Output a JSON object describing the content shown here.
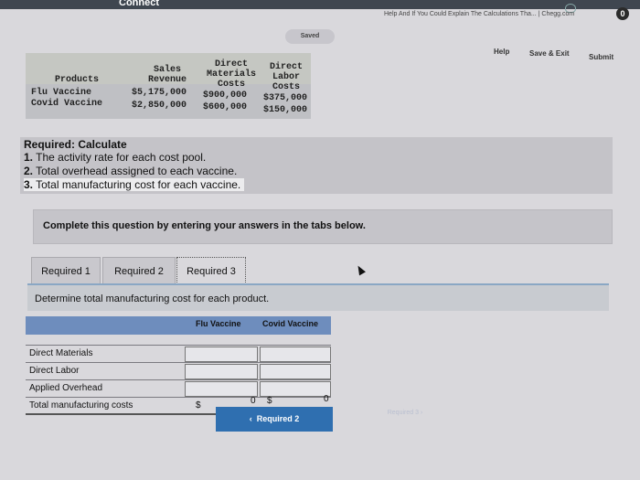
{
  "browser": {
    "connect_label": "Connect",
    "tab_title": "Help And If You Could Explain The Calculations Tha... | Chegg.com",
    "badge": "0"
  },
  "header": {
    "saved": "Saved",
    "help": "Help",
    "save_exit": "Save & Exit",
    "submit": "Submit"
  },
  "data_table": {
    "headers": {
      "products": "Products",
      "sales_revenue": [
        "Sales",
        "Revenue"
      ],
      "direct_materials": [
        "Direct",
        "Materials",
        "Costs"
      ],
      "direct_labor": [
        "Direct",
        "Labor",
        "Costs"
      ]
    },
    "rows": [
      {
        "product": "Flu Vaccine",
        "sales": "$5,175,000",
        "materials": "$900,000",
        "labor": "$375,000"
      },
      {
        "product": "Covid Vaccine",
        "sales": "$2,850,000",
        "materials": "$600,000",
        "labor": "$150,000"
      }
    ]
  },
  "required": {
    "title": "Required: Calculate",
    "items": [
      {
        "num": "1.",
        "text": " The activity rate for each cost pool."
      },
      {
        "num": "2.",
        "text": " Total overhead assigned to each vaccine."
      },
      {
        "num": "3.",
        "text": " Total manufacturing cost for each vaccine."
      }
    ]
  },
  "instruction": "Complete this question by entering your answers in the tabs below.",
  "tabs": [
    "Required 1",
    "Required 2",
    "Required 3"
  ],
  "prompt": "Determine total manufacturing cost for each product.",
  "answer_table": {
    "columns": [
      "Flu Vaccine",
      "Covid Vaccine"
    ],
    "rows": [
      "Direct Materials",
      "Direct Labor",
      "Applied Overhead",
      "Total manufacturing costs"
    ],
    "total_flu": "0",
    "total_covid": "0",
    "currency": "$"
  },
  "nav": {
    "prev": "Required 2",
    "next": "Required 3"
  }
}
